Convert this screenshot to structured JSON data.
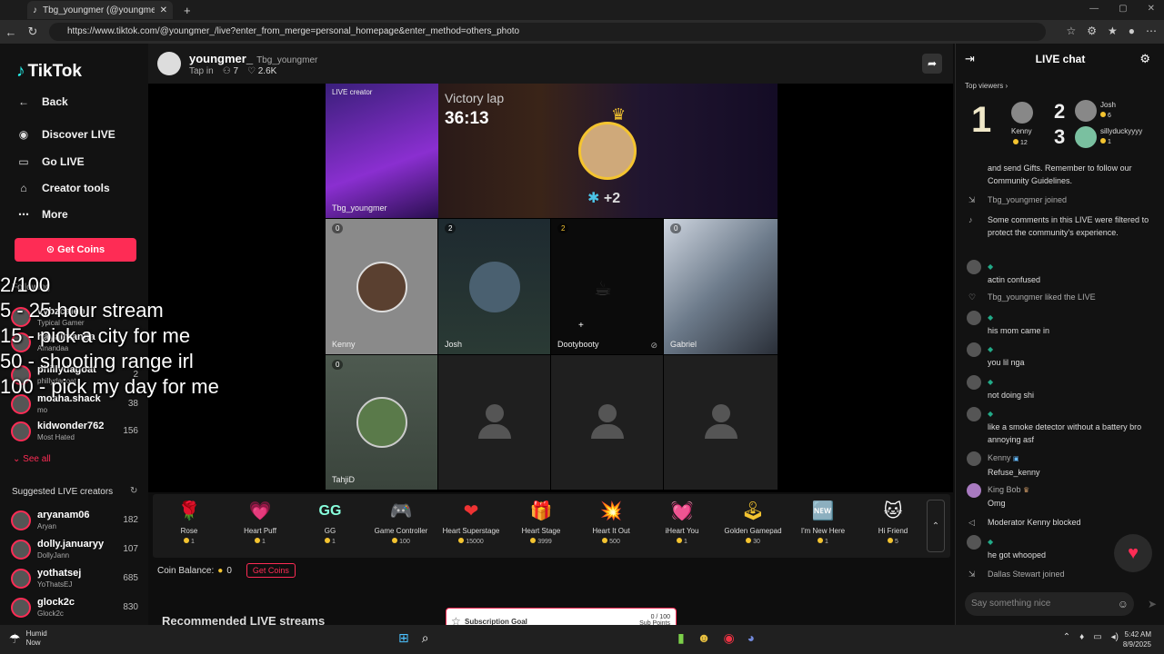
{
  "browser": {
    "tab_title": "Tbg_youngmer (@youngmer...",
    "url": "https://www.tiktok.com/@youngmer_/live?enter_from_merge=personal_homepage&enter_method=others_photo"
  },
  "sidebar": {
    "logo": "TikTok",
    "nav": [
      {
        "label": "Back",
        "icon": "arrow-left-icon"
      },
      {
        "label": "Discover LIVE",
        "icon": "live-icon"
      },
      {
        "label": "Go LIVE",
        "icon": "camera-icon"
      },
      {
        "label": "Creator tools",
        "icon": "home-icon"
      },
      {
        "label": "More",
        "icon": "more-icon"
      }
    ],
    "get_coins": "Get Coins",
    "following_label": "Following",
    "following": [
      {
        "name": "vybzcaleb",
        "sub": "Typical Gamer",
        "count": ""
      },
      {
        "name": "hayalmanda",
        "sub": "Amandaa",
        "count": ""
      },
      {
        "name": "phillydagoat",
        "sub": "phillydagoat",
        "count": "2"
      },
      {
        "name": "moaha.shack",
        "sub": "mo",
        "count": "38"
      },
      {
        "name": "kidwonder762",
        "sub": "Most Hated",
        "count": "156"
      }
    ],
    "see_all": "See all",
    "suggested_label": "Suggested LIVE creators",
    "suggested": [
      {
        "name": "aryanam06",
        "sub": "Aryan",
        "count": "182"
      },
      {
        "name": "dolly.januaryy",
        "sub": "DollyJann",
        "count": "107"
      },
      {
        "name": "yothatsej",
        "sub": "YoThatsEJ",
        "count": "685"
      },
      {
        "name": "glock2c",
        "sub": "Glock2c",
        "count": "830"
      }
    ]
  },
  "overlay_lines": [
    "2/100",
    "5 - 25 hour stream",
    "15 - pick a city for me",
    "50 - shooting range irl",
    "100 - pick my day for me"
  ],
  "header": {
    "name": "youngmer_",
    "username": "Tbg_youngmer",
    "tap_in": "Tap in",
    "viewers": "7",
    "likes": "2.6K"
  },
  "stage": {
    "creator_label": "LIVE creator",
    "creator_name": "Tbg_youngmer",
    "victory": "Victory lap",
    "timer": "36:13",
    "bonus": "+2",
    "guests": [
      {
        "name": "Kenny",
        "badge": "0"
      },
      {
        "name": "Josh",
        "badge": "2"
      },
      {
        "name": "Dootybooty",
        "badge": "2"
      },
      {
        "name": "Gabriel",
        "badge": "0"
      },
      {
        "name": "TahjiD",
        "badge": "0"
      }
    ]
  },
  "gifts": [
    {
      "name": "Rose",
      "price": "1",
      "icon": "🌹"
    },
    {
      "name": "Heart Puff",
      "price": "1",
      "icon": "💗"
    },
    {
      "name": "GG",
      "price": "1",
      "icon": "GG"
    },
    {
      "name": "Game Controller",
      "price": "100",
      "icon": "🎮"
    },
    {
      "name": "Heart Superstage",
      "price": "15000",
      "icon": "❤"
    },
    {
      "name": "Heart Stage",
      "price": "3999",
      "icon": "🎁"
    },
    {
      "name": "Heart It Out",
      "price": "500",
      "icon": "💥"
    },
    {
      "name": "iHeart You",
      "price": "1",
      "icon": "💓"
    },
    {
      "name": "Golden Gamepad",
      "price": "30",
      "icon": "🕹"
    },
    {
      "name": "I'm New Here",
      "price": "1",
      "icon": "🆕"
    },
    {
      "name": "Hi Friend",
      "price": "5",
      "icon": "🐱"
    }
  ],
  "coin_balance": {
    "label": "Coin Balance:",
    "value": "0",
    "get_coins": "Get Coins"
  },
  "recommended": "Recommended LIVE streams",
  "chat": {
    "title": "LIVE chat",
    "top_viewers": "Top viewers",
    "top": [
      {
        "rank": "1",
        "name": "Kenny",
        "coins": "12"
      },
      {
        "rank": "2",
        "name": "Josh",
        "coins": "6"
      },
      {
        "rank": "3",
        "name": "sillyduckyyyy",
        "coins": "1"
      }
    ],
    "messages": [
      {
        "type": "sys",
        "text": "and send Gifts. Remember to follow our Community Guidelines."
      },
      {
        "type": "join",
        "text": "Tbg_youngmer joined"
      },
      {
        "type": "sys2",
        "text": "Some comments in this LIVE were filtered to protect the community's experience."
      },
      {
        "type": "user",
        "text": "actin confused"
      },
      {
        "type": "like",
        "text": "Tbg_youngmer liked the LIVE"
      },
      {
        "type": "user",
        "text": "his mom came in"
      },
      {
        "type": "user",
        "text": "you lil nga"
      },
      {
        "type": "user",
        "text": "not doing shi"
      },
      {
        "type": "user",
        "text": "like a smoke detector without a battery bro annoying asf"
      },
      {
        "type": "named",
        "user": "Kenny",
        "text": "Refuse_kenny"
      },
      {
        "type": "named",
        "user": "King Bob",
        "text": "Omg"
      },
      {
        "type": "mod",
        "text": "Moderator Kenny blocked"
      },
      {
        "type": "user",
        "text": "he got whooped"
      },
      {
        "type": "join",
        "text": "Dallas Stewart joined"
      }
    ],
    "input_placeholder": "Say something nice"
  },
  "subscription_goal": {
    "title": "Subscription Goal",
    "value": "0 / 100",
    "unit": "Sub Points",
    "progress": 0
  },
  "taskbar": {
    "weather": "Humid",
    "weather_sub": "Now",
    "time": "5:42 AM",
    "date": "8/9/2025"
  }
}
